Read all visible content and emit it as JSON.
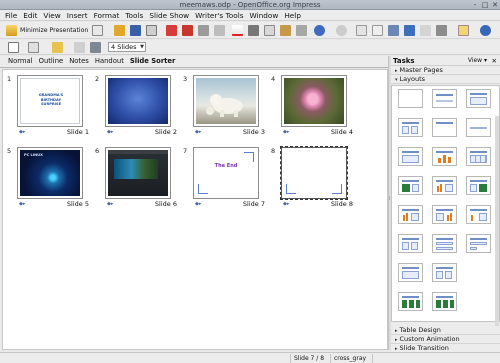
{
  "window": {
    "title": "meemaws.odp - OpenOffice.org Impress",
    "min_label": "-",
    "max_label": "□",
    "close_label": "✕"
  },
  "menu": [
    "File",
    "Edit",
    "View",
    "Insert",
    "Format",
    "Tools",
    "Slide Show",
    "Writer's Tools",
    "Window",
    "Help"
  ],
  "toolbar": {
    "minimize_presentation": "Minimize Presentation",
    "slides_per_row": "4 Slides"
  },
  "view_tabs": [
    "Normal",
    "Outline",
    "Notes",
    "Handout",
    "Slide Sorter"
  ],
  "active_tab": "Slide Sorter",
  "slides": [
    {
      "num": "1",
      "label": "Slide 1",
      "thumb": "title",
      "text": "GRANDMA'S BIRTHDAY SURPRISE"
    },
    {
      "num": "2",
      "label": "Slide 2",
      "thumb": "blue",
      "text": "· · ·"
    },
    {
      "num": "3",
      "label": "Slide 3",
      "thumb": "bear",
      "text": ""
    },
    {
      "num": "4",
      "label": "Slide 4",
      "thumb": "flower",
      "text": ""
    },
    {
      "num": "5",
      "label": "Slide 5",
      "thumb": "space",
      "text": "PC LINUX"
    },
    {
      "num": "6",
      "label": "Slide 6",
      "thumb": "screen",
      "text": ""
    },
    {
      "num": "7",
      "label": "Slide 7",
      "thumb": "end",
      "text": "The End"
    },
    {
      "num": "8",
      "label": "Slide 8",
      "thumb": "blank",
      "text": ""
    }
  ],
  "tasks": {
    "title": "Tasks",
    "view_label": "View ▾",
    "close": "✕",
    "master_pages": "Master Pages",
    "layouts": "Layouts",
    "table_design": "Table Design",
    "custom_animation": "Custom Animation",
    "slide_transition": "Slide Transition"
  },
  "status": {
    "slide": "Slide 7 / 8",
    "theme": "cross_gray"
  },
  "colors": {
    "accent_blue": "#5b7fc9",
    "chart_orange": "#e07d20",
    "picture_green": "#2a7c3a"
  }
}
